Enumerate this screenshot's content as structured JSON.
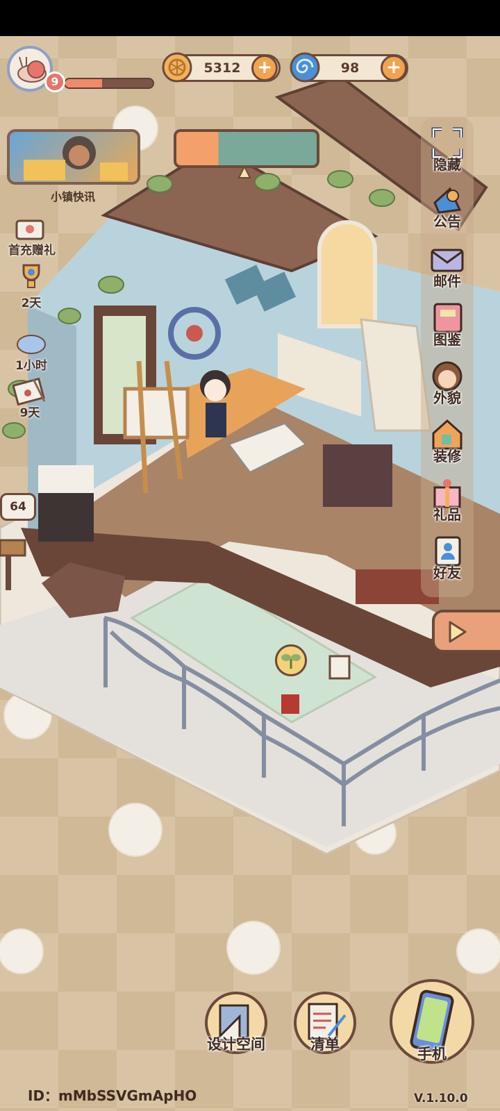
{
  "player": {
    "level": "9",
    "xp_fraction": 0.42
  },
  "currency": {
    "coins": "5312",
    "gems": "98"
  },
  "news": {
    "label": "小镇快讯"
  },
  "left_items": [
    {
      "name": "first-recharge-gift",
      "label": "首充赠礼"
    },
    {
      "name": "trophy-event",
      "label": "2天"
    },
    {
      "name": "hourly-event",
      "label": "1小时"
    },
    {
      "name": "letter-event",
      "label": "9天"
    }
  ],
  "right_menu": [
    {
      "name": "hide",
      "label": "隐藏"
    },
    {
      "name": "announcement",
      "label": "公告"
    },
    {
      "name": "mail",
      "label": "邮件"
    },
    {
      "name": "catalog",
      "label": "图鉴"
    },
    {
      "name": "appearance",
      "label": "外貌"
    },
    {
      "name": "decorate",
      "label": "装修"
    },
    {
      "name": "gift",
      "label": "礼品"
    },
    {
      "name": "friends",
      "label": "好友"
    }
  ],
  "mailbox_count": "64",
  "bottom": {
    "design": "设计空间",
    "list": "清单",
    "phone": "手机"
  },
  "footer": {
    "id_text": "ID：mMbSSVGmApHO",
    "version": "V.1.10.0"
  },
  "colors": {
    "accent": "#f1a44f",
    "outline": "#6b4a3a",
    "coin": "#f2b25a",
    "gem": "#4a8fd8"
  }
}
